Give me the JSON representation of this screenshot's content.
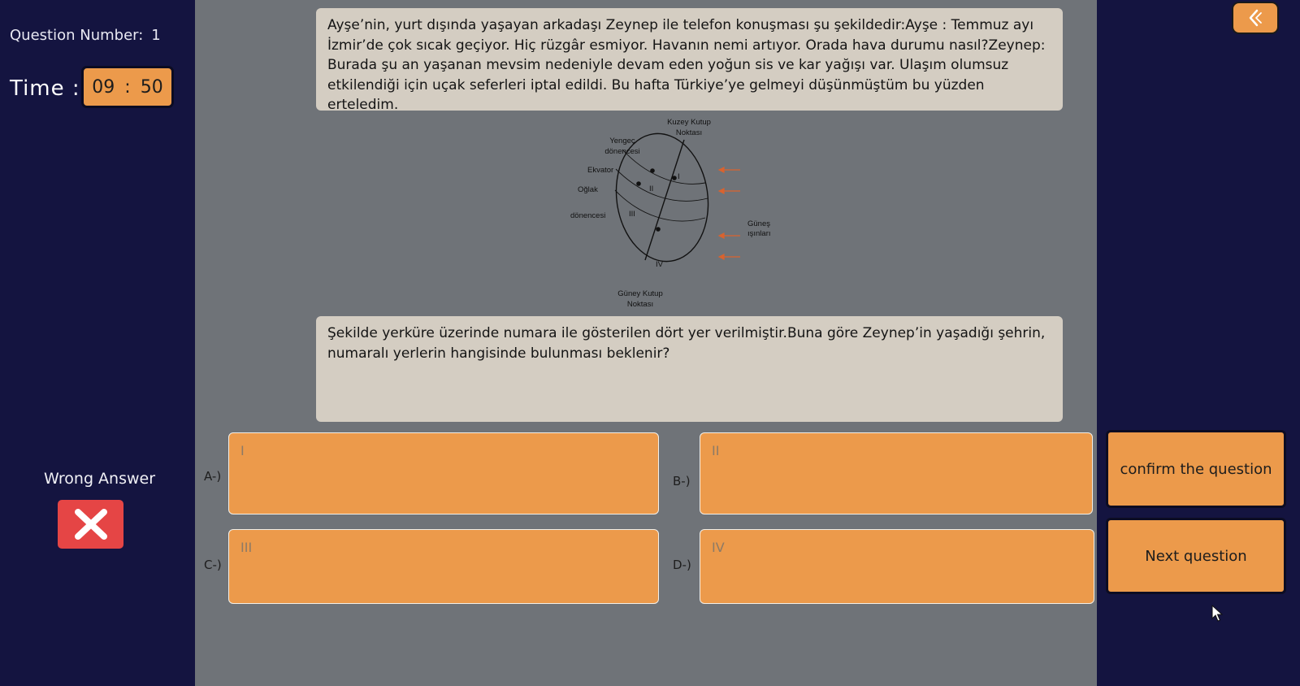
{
  "header": {
    "question_number_label": "Question Number:",
    "question_number": "1",
    "time_label": "Time :",
    "time_minutes": "09",
    "time_separator": ":",
    "time_seconds": "50"
  },
  "feedback": {
    "status_text": "Wrong Answer",
    "status_icon": "close-icon",
    "status_color": "#e54545"
  },
  "passage": {
    "text": "Ayşe’nin, yurt dışında yaşayan arkadaşı Zeynep ile telefon konuşması şu şekildedir:Ayşe            : Temmuz ayı İzmir’de çok sıcak geçiyor. Hiç rüzgâr esmiyor. Havanın nemi artıyor. Orada hava durumu nasıl?Zeynep: Burada şu an yaşanan mevsim nedeniyle devam eden yoğun sis ve kar yağışı var. Ulaşım olumsuz etkilendiği için uçak seferleri iptal edildi. Bu hafta Türkiye’ye gelmeyi düşünmüştüm bu yüzden erteledim."
  },
  "figure": {
    "north_pole_line1": "Kuzey Kutup",
    "north_pole_line2": "Noktası",
    "cancer_line1": "Yengeç",
    "cancer_line2": "dönencesi",
    "equator": "Ekvator",
    "capricorn_line1": "Oğlak",
    "capricorn_line2": "dönencesi",
    "sun_rays_line1": "Güneş",
    "sun_rays_line2": "ışınları",
    "south_pole_line1": "Güney Kutup",
    "south_pole_line2": "Noktası",
    "point_1": "I",
    "point_2": "II",
    "point_3": "III",
    "point_4": "IV"
  },
  "question": {
    "text": "Şekilde yerküre üzerinde numara ile gösterilen dört yer verilmiştir.Buna göre Zeynep’in yaşadığı şehrin, numaralı yerlerin hangisinde bulunması beklenir?"
  },
  "options": [
    {
      "label": "A-)",
      "text": "I"
    },
    {
      "label": "B-)",
      "text": "II"
    },
    {
      "label": "C-)",
      "text": "III"
    },
    {
      "label": "D-)",
      "text": "IV"
    }
  ],
  "buttons": {
    "back_icon": "chevron-left-icon",
    "confirm": "confirm the question",
    "next": "Next question"
  },
  "colors": {
    "background": "#141440",
    "main_area": "#6f7378",
    "accent": "#ec9a4b",
    "text_box": "#d4cdc2"
  }
}
